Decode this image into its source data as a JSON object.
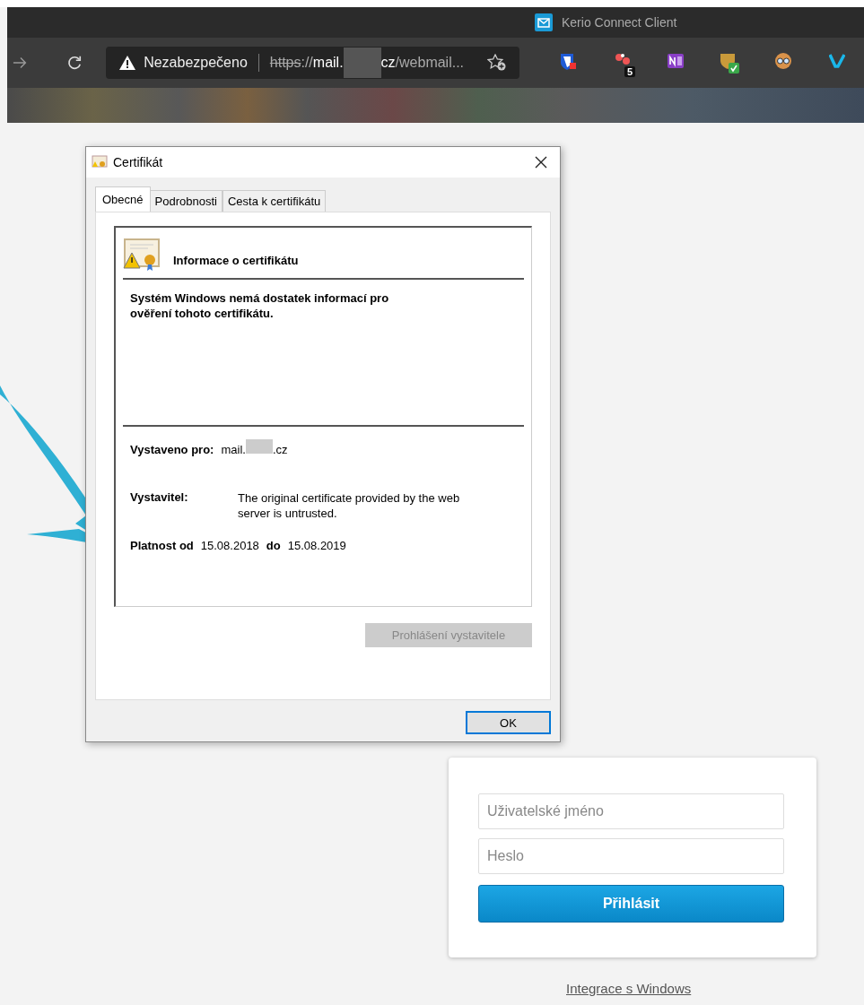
{
  "browser": {
    "tab_title": "Kerio Connect Client",
    "security_label": "Nezabezpečeno",
    "url": {
      "scheme": "https",
      "separator": "://",
      "host_start": "mail.",
      "host_end": "cz",
      "path": "/webmail..."
    },
    "extension_badge": "5"
  },
  "dialog": {
    "title": "Certifikát",
    "tabs": [
      {
        "label": "Obecné",
        "selected": true
      },
      {
        "label": "Podrobnosti",
        "selected": false
      },
      {
        "label": "Cesta k certifikátu",
        "selected": false
      }
    ],
    "heading": "Informace o certifikátu",
    "message": "Systém Windows nemá dostatek informací pro ověření tohoto certifikátu.",
    "issued_to_label": "Vystaveno pro:",
    "issued_to_start": "mail.",
    "issued_to_end": ".cz",
    "issuer_label": "Vystavitel:",
    "issuer": "The original certificate provided by the web server is untrusted.",
    "valid_from_label": "Platnost od",
    "valid_from": "15.08.2018",
    "valid_to_label": "do",
    "valid_to": "15.08.2019",
    "statement_button": {
      "label": "Prohlášení vystavitele",
      "disabled": true
    },
    "ok_button": "OK"
  },
  "login": {
    "username": {
      "placeholder": "Uživatelské jméno"
    },
    "password": {
      "placeholder": "Heslo"
    },
    "submit": "Přihlásit",
    "link": "Integrace s Windows"
  }
}
